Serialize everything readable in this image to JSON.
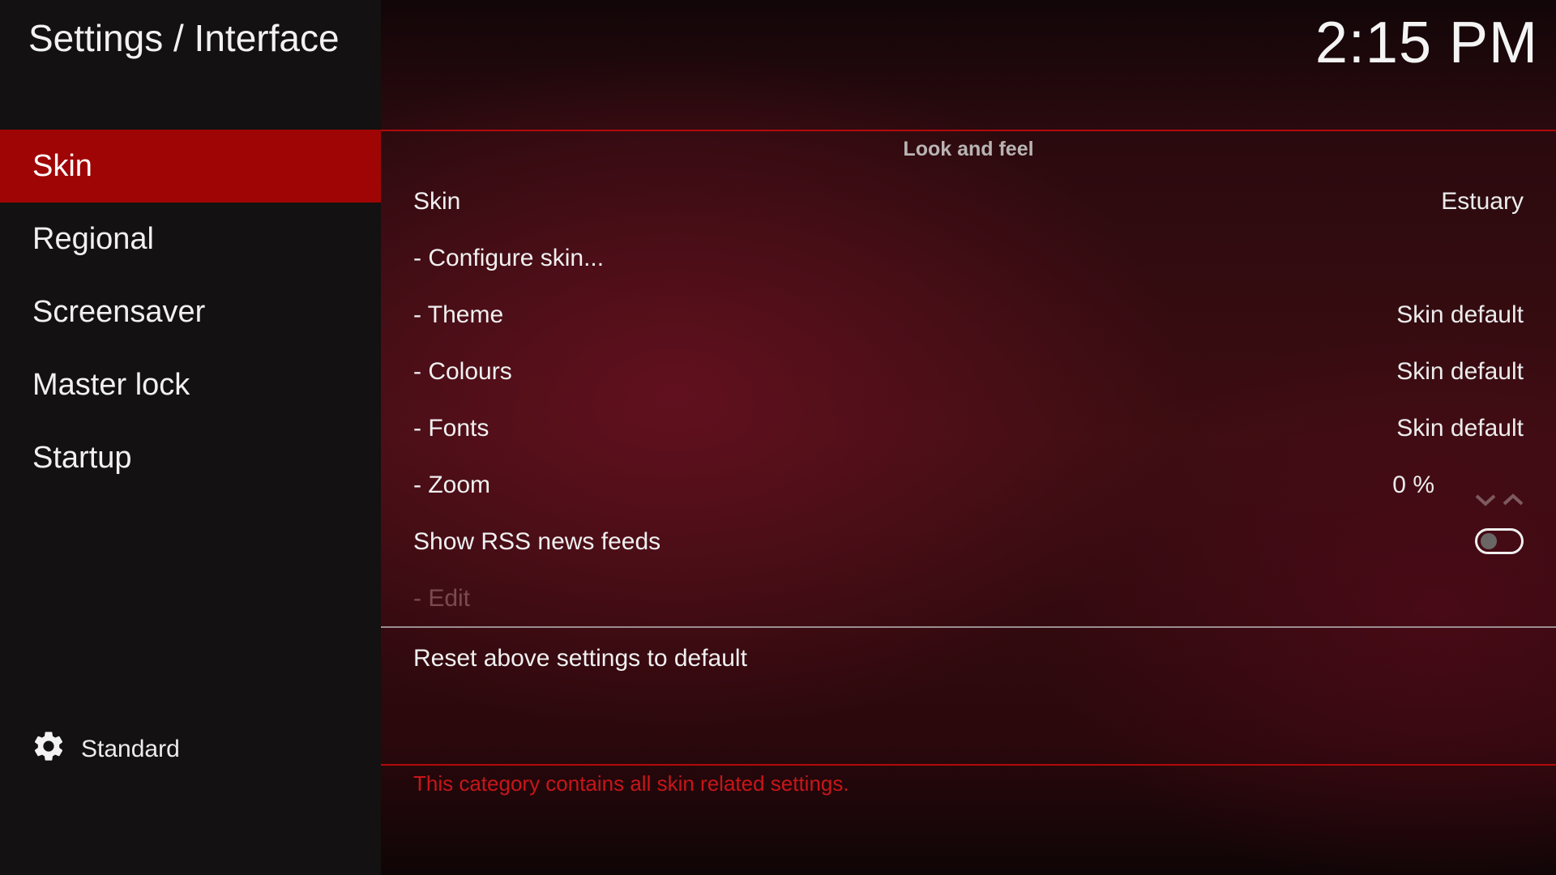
{
  "header": {
    "title": "Settings / Interface",
    "clock": "2:15 PM"
  },
  "sidebar": {
    "items": [
      {
        "label": "Skin",
        "active": true
      },
      {
        "label": "Regional",
        "active": false
      },
      {
        "label": "Screensaver",
        "active": false
      },
      {
        "label": "Master lock",
        "active": false
      },
      {
        "label": "Startup",
        "active": false
      }
    ],
    "level": {
      "label": "Standard",
      "icon": "gear-icon"
    }
  },
  "main": {
    "group_header": "Look and feel",
    "settings": [
      {
        "label": "Skin",
        "value": "Estuary"
      },
      {
        "label": "- Configure skin...",
        "value": ""
      },
      {
        "label": "- Theme",
        "value": "Skin default"
      },
      {
        "label": "- Colours",
        "value": "Skin default"
      },
      {
        "label": "- Fonts",
        "value": "Skin default"
      },
      {
        "label": "- Zoom",
        "value": "0 %"
      },
      {
        "label": "Show RSS news feeds",
        "value": "off"
      },
      {
        "label": "- Edit",
        "value": "",
        "disabled": true
      }
    ],
    "reset_label": "Reset above settings to default",
    "description": "This category contains all skin related settings."
  },
  "colors": {
    "accent": "#a00505",
    "description_text": "#c8161a",
    "sidebar_bg": "#131111"
  }
}
